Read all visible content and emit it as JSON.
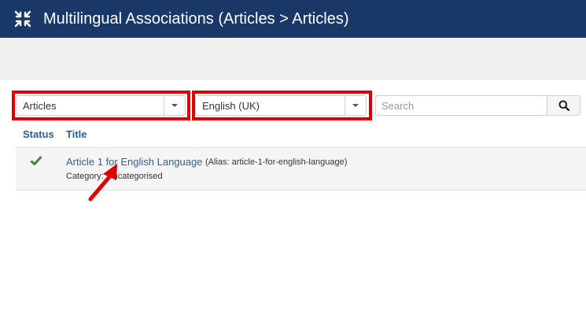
{
  "header": {
    "title": "Multilingual Associations (Articles > Articles)",
    "icon": "compress-icon",
    "bg_color": "#1a3867"
  },
  "filters": {
    "item_type": {
      "selected": "Articles",
      "icon": "chevron-down-icon"
    },
    "language": {
      "selected": "English (UK)",
      "icon": "chevron-down-icon"
    },
    "search": {
      "placeholder": "Search",
      "value": "",
      "button_icon": "search-icon"
    },
    "highlight_color": "#e00000"
  },
  "table": {
    "columns": [
      "Status",
      "Title"
    ],
    "rows": [
      {
        "status_icon": "check-icon",
        "status_color": "#3c8b3c",
        "title": "Article 1 for English Language",
        "alias_label": "(Alias: article-1-for-english-language)",
        "category_label": "Category:",
        "category_value": "Uncategorised"
      }
    ]
  },
  "annotation": {
    "icon": "red-arrow-icon",
    "color": "#e00000"
  }
}
